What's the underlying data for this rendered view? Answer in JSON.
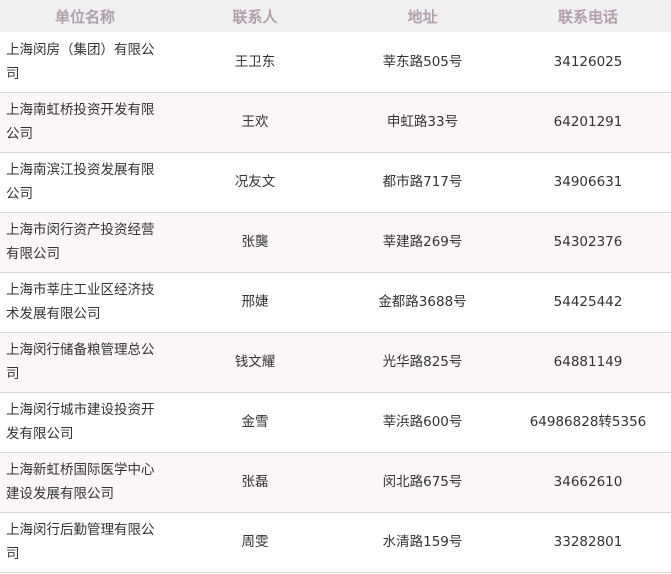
{
  "headers": [
    "单位名称",
    "联系人",
    "地址",
    "联系电话"
  ],
  "rows": [
    {
      "unit": "上海闵房（集团）有限公司",
      "contact": "王卫东",
      "address": "莘东路505号",
      "phone": "34126025"
    },
    {
      "unit": "上海南虹桥投资开发有限公司",
      "contact": "王欢",
      "address": "申虹路33号",
      "phone": "64201291"
    },
    {
      "unit": "上海南滨江投资发展有限公司",
      "contact": "况友文",
      "address": "都市路717号",
      "phone": "34906631"
    },
    {
      "unit": "上海市闵行资产投资经营有限公司",
      "contact": "张龑",
      "address": "莘建路269号",
      "phone": "54302376"
    },
    {
      "unit": "上海市莘庄工业区经济技术发展有限公司",
      "contact": "邢婕",
      "address": "金都路3688号",
      "phone": "54425442"
    },
    {
      "unit": "上海闵行储备粮管理总公司",
      "contact": "钱文耀",
      "address": "光华路825号",
      "phone": "64881149"
    },
    {
      "unit": "上海闵行城市建设投资开发有限公司",
      "contact": "金雪",
      "address": "莘浜路600号",
      "phone": "64986828转5356"
    },
    {
      "unit": "上海新虹桥国际医学中心建设发展有限公司",
      "contact": "张磊",
      "address": "闵北路675号",
      "phone": "34662610"
    },
    {
      "unit": "上海闵行后勤管理有限公司",
      "contact": "周雯",
      "address": "水清路159号",
      "phone": "33282801"
    }
  ]
}
